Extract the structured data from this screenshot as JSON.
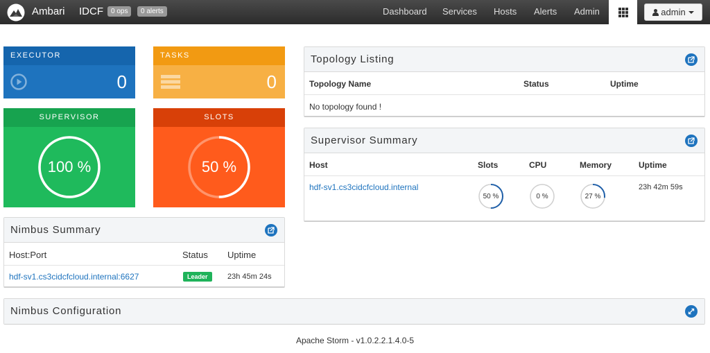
{
  "navbar": {
    "brand": "Ambari",
    "cluster": "IDCF",
    "ops_badge": "0 ops",
    "alerts_badge": "0 alerts",
    "items": [
      {
        "label": "Dashboard"
      },
      {
        "label": "Services"
      },
      {
        "label": "Hosts"
      },
      {
        "label": "Alerts"
      },
      {
        "label": "Admin"
      }
    ],
    "user": "admin"
  },
  "tiles": {
    "executor": {
      "title": "EXECUTOR",
      "value": "0",
      "color": "#1e73be"
    },
    "tasks": {
      "title": "TASKS",
      "value": "0",
      "color": "#f7a530"
    },
    "supervisor": {
      "title": "SUPERVISOR",
      "value": "100 %",
      "percent": 100,
      "color": "#1fb35a"
    },
    "slots": {
      "title": "SLOTS",
      "value": "50 %",
      "percent": 50,
      "color": "#ff5a1a"
    }
  },
  "topology": {
    "title": "Topology Listing",
    "columns": [
      "Topology Name",
      "Status",
      "Uptime"
    ],
    "empty_message": "No topology found !"
  },
  "supervisor_summary": {
    "title": "Supervisor Summary",
    "columns": [
      "Host",
      "Slots",
      "CPU",
      "Memory",
      "Uptime"
    ],
    "rows": [
      {
        "host": "hdf-sv1.cs3cidcfcloud.internal",
        "slots": "50 %",
        "slots_pct": 50,
        "cpu": "0 %",
        "cpu_pct": 0,
        "memory": "27 %",
        "memory_pct": 27,
        "uptime": "23h 42m 59s"
      }
    ]
  },
  "nimbus_summary": {
    "title": "Nimbus Summary",
    "columns": [
      "Host:Port",
      "Status",
      "Uptime"
    ],
    "rows": [
      {
        "host": "hdf-sv1.cs3cidcfcloud.internal:6627",
        "status": "Leader",
        "uptime": "23h 45m 24s"
      }
    ]
  },
  "nimbus_config": {
    "title": "Nimbus Configuration"
  },
  "footer": "Apache Storm - v1.0.2.2.1.4.0-5"
}
